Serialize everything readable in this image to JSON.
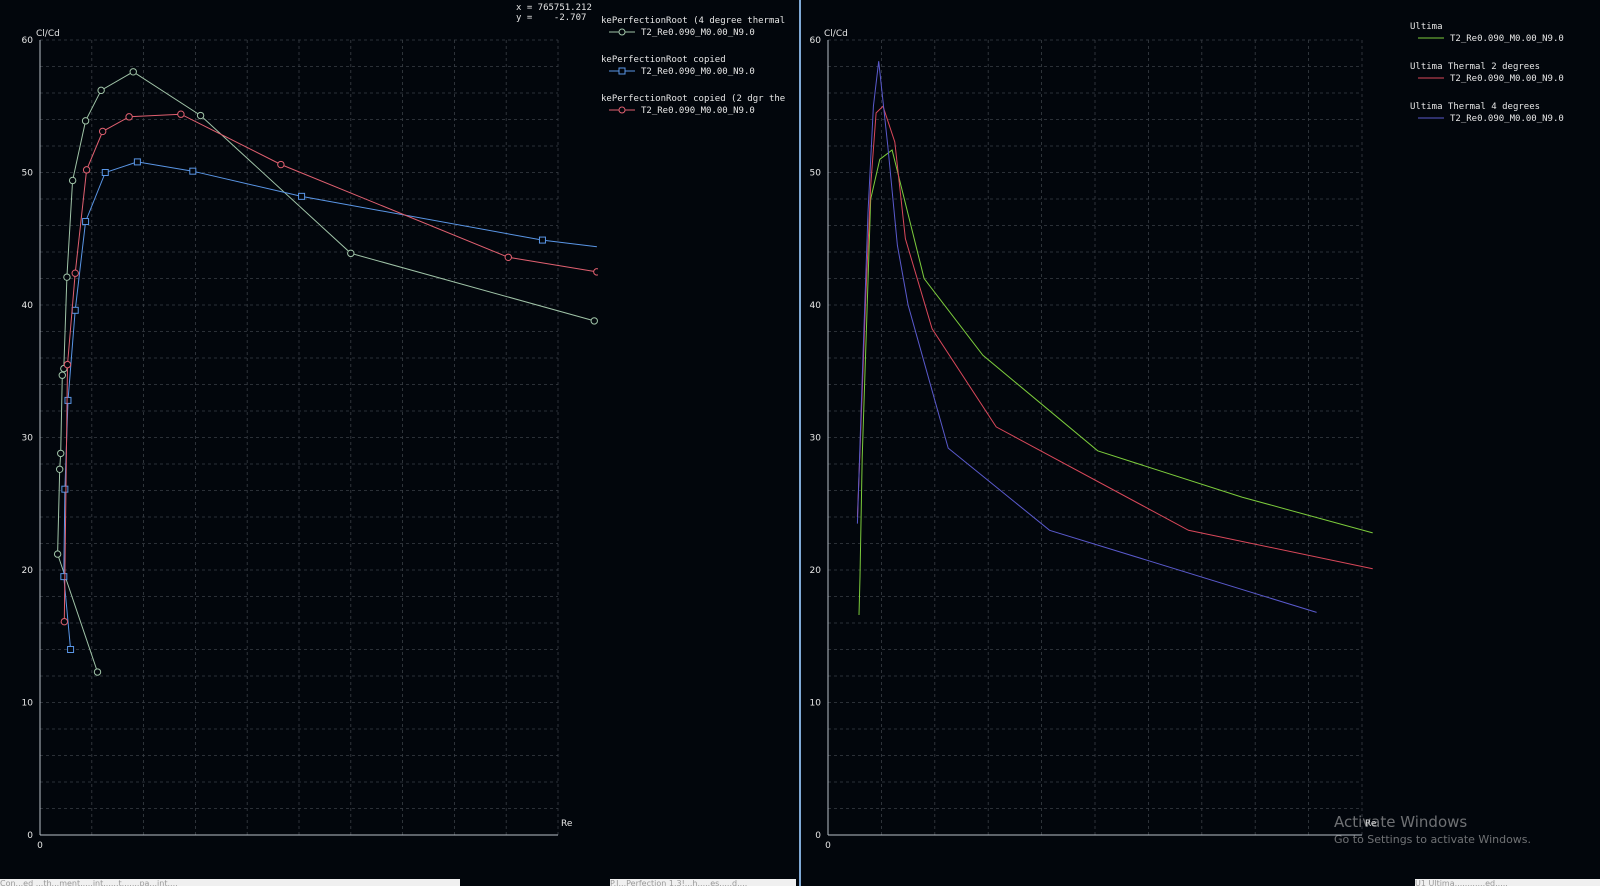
{
  "cursor": {
    "x_line": "x = 765751.212",
    "y_line": "y =    -2.707"
  },
  "watermark": {
    "title": "Activate Windows",
    "subtitle": "Go to Settings to activate Windows."
  },
  "status_left": "Con...ed ...th...ment.....int......t.......pa...int....",
  "status_mid": "P.I...Perfection 1.3!...h.....es.....d....",
  "status_right": "U1 Ultima............ed.....",
  "chart_data": [
    {
      "type": "line",
      "ylabel": "Cl/Cd",
      "xlabel": "Re",
      "ylim": [
        0,
        60
      ],
      "yticks": [
        0,
        10,
        20,
        30,
        40,
        50,
        60
      ],
      "xlim": [
        0,
        1000000
      ],
      "xticks": [
        0
      ],
      "grid": true,
      "markers": true,
      "legend": "right",
      "series": [
        {
          "group": "kePerfectionRoot (4 degree thermal",
          "name": "T2_Re0.090_M0.00_N9.0",
          "color": "#a0c4a8",
          "marker": "circle",
          "x": [
            111000,
            34000,
            38000,
            40000,
            43000,
            46000,
            52000,
            63000,
            88000,
            118000,
            180000,
            310000,
            600000,
            1070000
          ],
          "y": [
            12.3,
            21.2,
            27.6,
            28.8,
            34.7,
            35.2,
            42.1,
            49.4,
            53.9,
            56.2,
            57.6,
            54.3,
            43.9,
            38.8
          ]
        },
        {
          "group": "kePerfectionRoot copied",
          "name": "T2_Re0.090_M0.00_N9.0",
          "color": "#5a96e6",
          "marker": "square",
          "x": [
            59000,
            46000,
            48000,
            54000,
            68000,
            88000,
            126000,
            188000,
            295000,
            505000,
            970000,
            1075000
          ],
          "y": [
            14.0,
            19.5,
            26.1,
            32.8,
            39.6,
            46.3,
            50.0,
            50.8,
            50.1,
            48.2,
            44.9,
            44.4
          ],
          "visible_markers": 11
        },
        {
          "group": "kePerfectionRoot copied (2 dgr the",
          "name": "T2_Re0.090_M0.00_N9.0",
          "color": "#e06070",
          "marker": "circle",
          "x": [
            47000,
            53000,
            68000,
            90000,
            121000,
            172000,
            272000,
            465000,
            904000,
            1075000
          ],
          "y": [
            16.1,
            35.5,
            42.4,
            50.2,
            53.1,
            54.2,
            54.4,
            50.6,
            43.6,
            42.5
          ]
        }
      ]
    },
    {
      "type": "line",
      "ylabel": "Cl/Cd",
      "xlabel": "Re",
      "ylim": [
        0,
        60
      ],
      "yticks": [
        0,
        10,
        20,
        30,
        40,
        50,
        60
      ],
      "xlim": [
        0,
        1000000
      ],
      "xticks": [
        0
      ],
      "grid": true,
      "markers": false,
      "legend": "right",
      "series": [
        {
          "group": "Ultima",
          "name": "T2_Re0.090_M0.00_N9.0",
          "color": "#7ccc3c",
          "x": [
            58000,
            60000,
            64000,
            80000,
            97000,
            120000,
            180000,
            290000,
            505000,
            775000,
            1020000
          ],
          "y": [
            16.6,
            19.5,
            28.5,
            48.0,
            51.0,
            51.7,
            42.0,
            36.2,
            29.0,
            25.5,
            22.8
          ]
        },
        {
          "group": "Ultima Thermal 2 degrees",
          "name": "T2_Re0.090_M0.00_N9.0",
          "color": "#d9485a",
          "x": [
            55000,
            60000,
            70000,
            80000,
            90000,
            103000,
            125000,
            145000,
            195000,
            315000,
            675000,
            1020000
          ],
          "y": [
            24.0,
            29.0,
            40.0,
            49.0,
            54.5,
            55.0,
            52.3,
            45.0,
            38.2,
            30.8,
            23.0,
            20.1
          ]
        },
        {
          "group": "Ultima Thermal 4 degrees",
          "name": "T2_Re0.090_M0.00_N9.0",
          "color": "#5a5acd",
          "x": [
            55000,
            62000,
            75000,
            85000,
            95000,
            112000,
            130000,
            150000,
            225000,
            415000,
            915000
          ],
          "y": [
            23.5,
            32.0,
            47.0,
            55.0,
            58.4,
            52.0,
            44.5,
            40.0,
            29.2,
            23.0,
            16.8
          ]
        }
      ]
    }
  ]
}
